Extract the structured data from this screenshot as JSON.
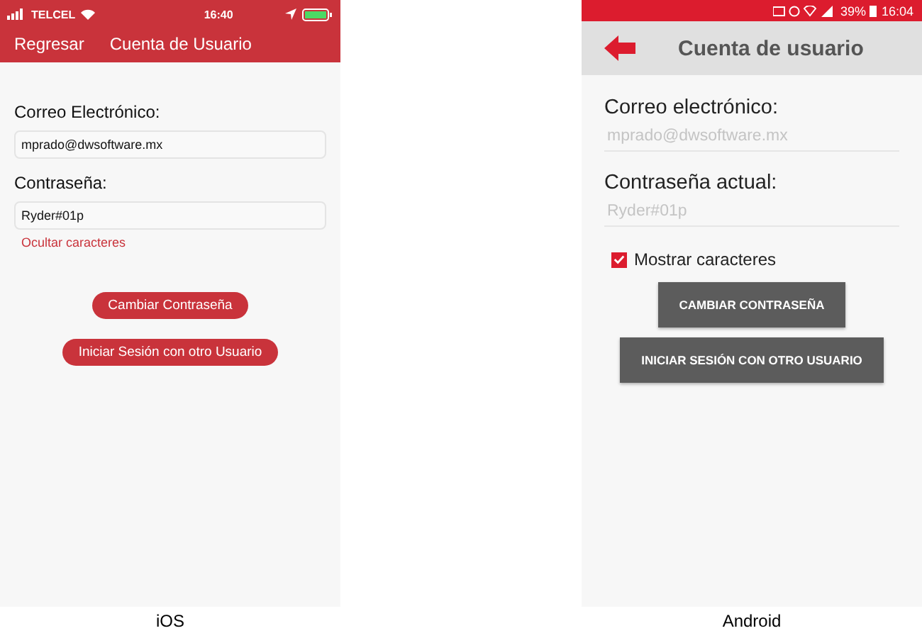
{
  "ios": {
    "status_bar": {
      "carrier": "TELCEL",
      "time": "16:40"
    },
    "nav_bar": {
      "back": "Regresar",
      "title": "Cuenta de Usuario"
    },
    "fields": [
      {
        "label": "Correo Electrónico:",
        "value": "mprado@dwsoftware.mx"
      },
      {
        "label": "Contraseña:",
        "value": "Ryder#01p"
      }
    ],
    "toggle_link": "Ocultar caracteres",
    "buttons": [
      "Cambiar Contraseña",
      "Iniciar Sesión con otro Usuario"
    ],
    "caption": "iOS"
  },
  "android": {
    "status_bar": {
      "battery": "39%",
      "time": "16:04"
    },
    "toolbar": {
      "title": "Cuenta de usuario"
    },
    "fields": [
      {
        "label": "Correo electrónico:",
        "value": "mprado@dwsoftware.mx",
        "disabled": true
      },
      {
        "label": "Contraseña actual:",
        "value": "Ryder#01p",
        "disabled": true
      }
    ],
    "checkbox": {
      "label": "Mostrar caracteres",
      "checked": true
    },
    "buttons": [
      "CAMBIAR CONTRASEÑA",
      "INICIAR SESIÓN CON OTRO USUARIO"
    ],
    "caption": "Android"
  }
}
